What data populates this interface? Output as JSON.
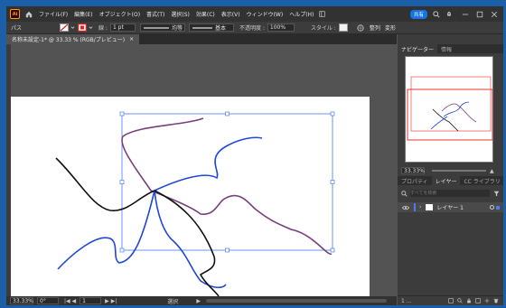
{
  "app": {
    "logo": "Ai"
  },
  "menu": [
    "ファイル(F)",
    "編集(E)",
    "オブジェクト(O)",
    "書式(T)",
    "選択(S)",
    "効果(C)",
    "表示(V)",
    "ウィンドウ(W)",
    "ヘルプ(H)"
  ],
  "title_bar": {
    "share_label": "共有"
  },
  "options_bar": {
    "selection_label": "パス",
    "stroke_label": "線 :",
    "stroke_value": "1 pt",
    "profile_label": "均等",
    "brush_label": "基本",
    "opacity_label": "不透明度 :",
    "opacity_value": "100%",
    "style_label": "スタイル :",
    "align_label": "整列",
    "transform_label": "変形"
  },
  "document_tab": {
    "label": "名称未設定-1* @ 33.33 % (RGB/プレビュー)",
    "close": "×"
  },
  "status_bar": {
    "zoom": "33.33%",
    "rotation": "0°",
    "artboard_no": "1",
    "tool_label": "選択"
  },
  "right_panel": {
    "tabs_top": [
      "ナビゲーター",
      "情報"
    ],
    "nav_zoom": "33.33%",
    "tabs_mid": [
      "プロパティ",
      "レイヤー",
      "CC ライブラリ"
    ],
    "search_placeholder": "すべてを検索",
    "layer_name": "レイヤー 1",
    "layer_count": "1 ..."
  },
  "colors": {
    "accent": "#1473e6",
    "path_purple": "#7a3f7a",
    "path_blue": "#1f47d8",
    "path_black": "#111111",
    "selection": "#4a7cf0",
    "nav_red": "#e83030"
  },
  "icons": [
    "home-icon",
    "stroke-swatch-icon",
    "fill-swatch-icon",
    "chevron-down-icon",
    "globe-icon",
    "search-icon",
    "rocket-icon",
    "layout-icon",
    "minimize-icon",
    "maximize-icon",
    "close-icon",
    "eye-icon",
    "filter-icon",
    "lock-icon",
    "trash-icon"
  ]
}
